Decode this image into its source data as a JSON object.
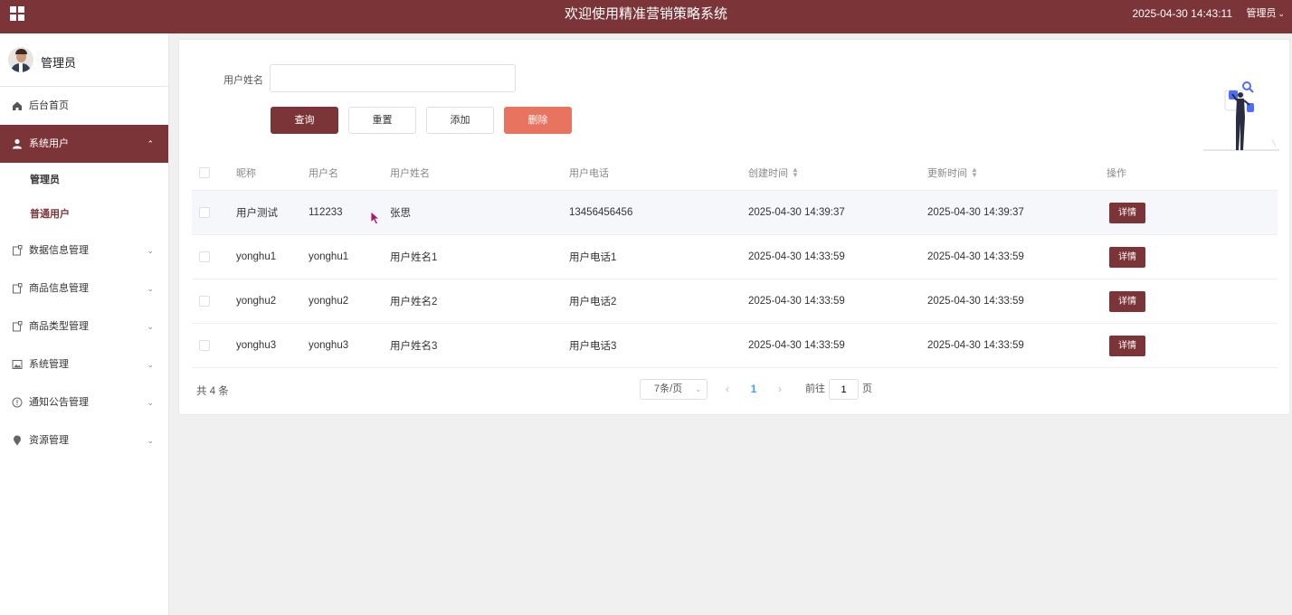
{
  "header": {
    "title": "欢迎使用精准营销策略系统",
    "datetime": "2025-04-30 14:43:11",
    "user_menu": "管理员",
    "bg_color": "#7b3538"
  },
  "sidebar": {
    "profile_name": "管理员",
    "items": [
      {
        "label": "后台首页",
        "icon": "home-icon"
      },
      {
        "label": "系统用户",
        "icon": "user-icon",
        "expanded": true,
        "children": [
          "管理员",
          "普通用户"
        ]
      },
      {
        "label": "数据信息管理",
        "icon": "clipboard-icon"
      },
      {
        "label": "商品信息管理",
        "icon": "clipboard-icon"
      },
      {
        "label": "商品类型管理",
        "icon": "clipboard-icon"
      },
      {
        "label": "系统管理",
        "icon": "image-icon"
      },
      {
        "label": "通知公告管理",
        "icon": "info-icon"
      },
      {
        "label": "资源管理",
        "icon": "location-icon"
      }
    ]
  },
  "search": {
    "label": "用户姓名",
    "value": "",
    "buttons": {
      "query": "查询",
      "reset": "重置",
      "add": "添加",
      "delete": "删除"
    }
  },
  "table": {
    "headers": {
      "nickname": "昵称",
      "username": "用户名",
      "realname": "用户姓名",
      "phone": "用户电话",
      "created": "创建时间",
      "updated": "更新时间",
      "action": "操作"
    },
    "rows": [
      {
        "nickname": "用户测试",
        "username": "112233",
        "realname": "张思",
        "phone": "13456456456",
        "created": "2025-04-30 14:39:37",
        "updated": "2025-04-30 14:39:37",
        "action": "详情"
      },
      {
        "nickname": "yonghu1",
        "username": "yonghu1",
        "realname": "用户姓名1",
        "phone": "用户电话1",
        "created": "2025-04-30 14:33:59",
        "updated": "2025-04-30 14:33:59",
        "action": "详情"
      },
      {
        "nickname": "yonghu2",
        "username": "yonghu2",
        "realname": "用户姓名2",
        "phone": "用户电话2",
        "created": "2025-04-30 14:33:59",
        "updated": "2025-04-30 14:33:59",
        "action": "详情"
      },
      {
        "nickname": "yonghu3",
        "username": "yonghu3",
        "realname": "用户姓名3",
        "phone": "用户电话3",
        "created": "2025-04-30 14:33:59",
        "updated": "2025-04-30 14:33:59",
        "action": "详情"
      }
    ]
  },
  "pagination": {
    "total": "共 4 条",
    "page_size": "7条/页",
    "current_page": "1",
    "goto_label": "前往",
    "goto_value": "1",
    "goto_suffix": "页"
  }
}
